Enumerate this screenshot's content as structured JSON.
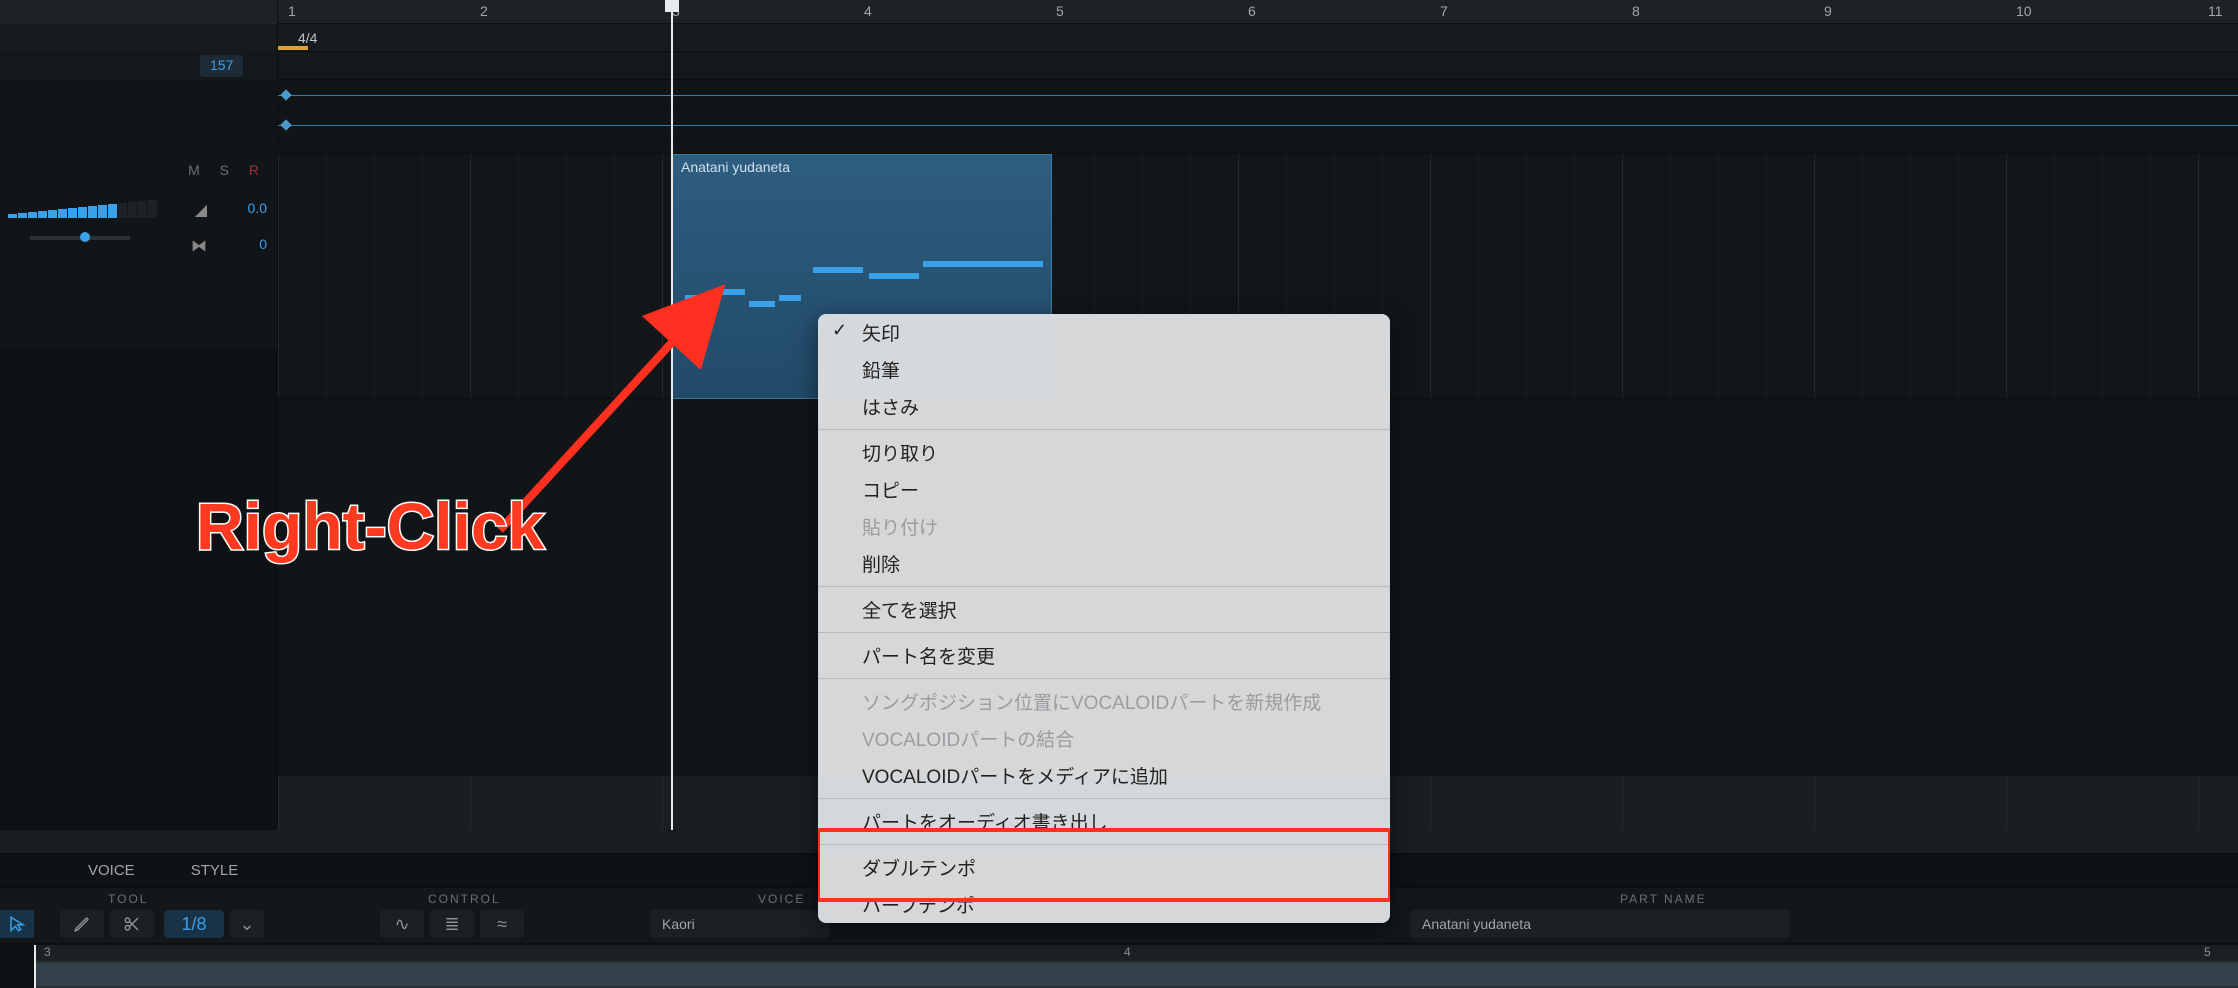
{
  "ruler": {
    "bars": [
      1,
      2,
      3,
      4,
      5,
      6,
      7,
      8,
      9,
      10,
      11
    ]
  },
  "timesig": {
    "value": "4/4"
  },
  "tempo": {
    "value": "157"
  },
  "track": {
    "mute": "M",
    "solo": "S",
    "rec": "R",
    "db": "0.0",
    "pan": "0"
  },
  "clip": {
    "title": "Anatani yudaneta"
  },
  "annotation": {
    "label": "Right-Click"
  },
  "context_menu": {
    "group1": [
      "矢印",
      "鉛筆",
      "はさみ"
    ],
    "group2": [
      "切り取り",
      "コピー",
      "貼り付け",
      "削除"
    ],
    "group3": [
      "全てを選択"
    ],
    "group4": [
      "パート名を変更"
    ],
    "group5": [
      "ソングポジション位置にVOCALOIDパートを新規作成",
      "VOCALOIDパートの結合",
      "VOCALOIDパートをメディアに追加"
    ],
    "group6": [
      "パートをオーディオ書き出し"
    ],
    "group7": [
      "ダブルテンポ",
      "ハーフテンポ"
    ],
    "checked_index": 0,
    "disabled": [
      "貼り付け",
      "ソングポジション位置にVOCALOIDパートを新規作成",
      "VOCALOIDパートの結合"
    ]
  },
  "tabs": {
    "voice": "VOICE",
    "style": "STYLE"
  },
  "controls": {
    "tool_label": "TOOL",
    "quantize": "1/8",
    "control_label": "CONTROL",
    "voice_label": "VOICE",
    "voice_value": "Kaori",
    "partname_label": "PART NAME",
    "partname_value": "Anatani yudaneta"
  },
  "mini": {
    "bars": [
      3,
      4,
      5
    ]
  }
}
